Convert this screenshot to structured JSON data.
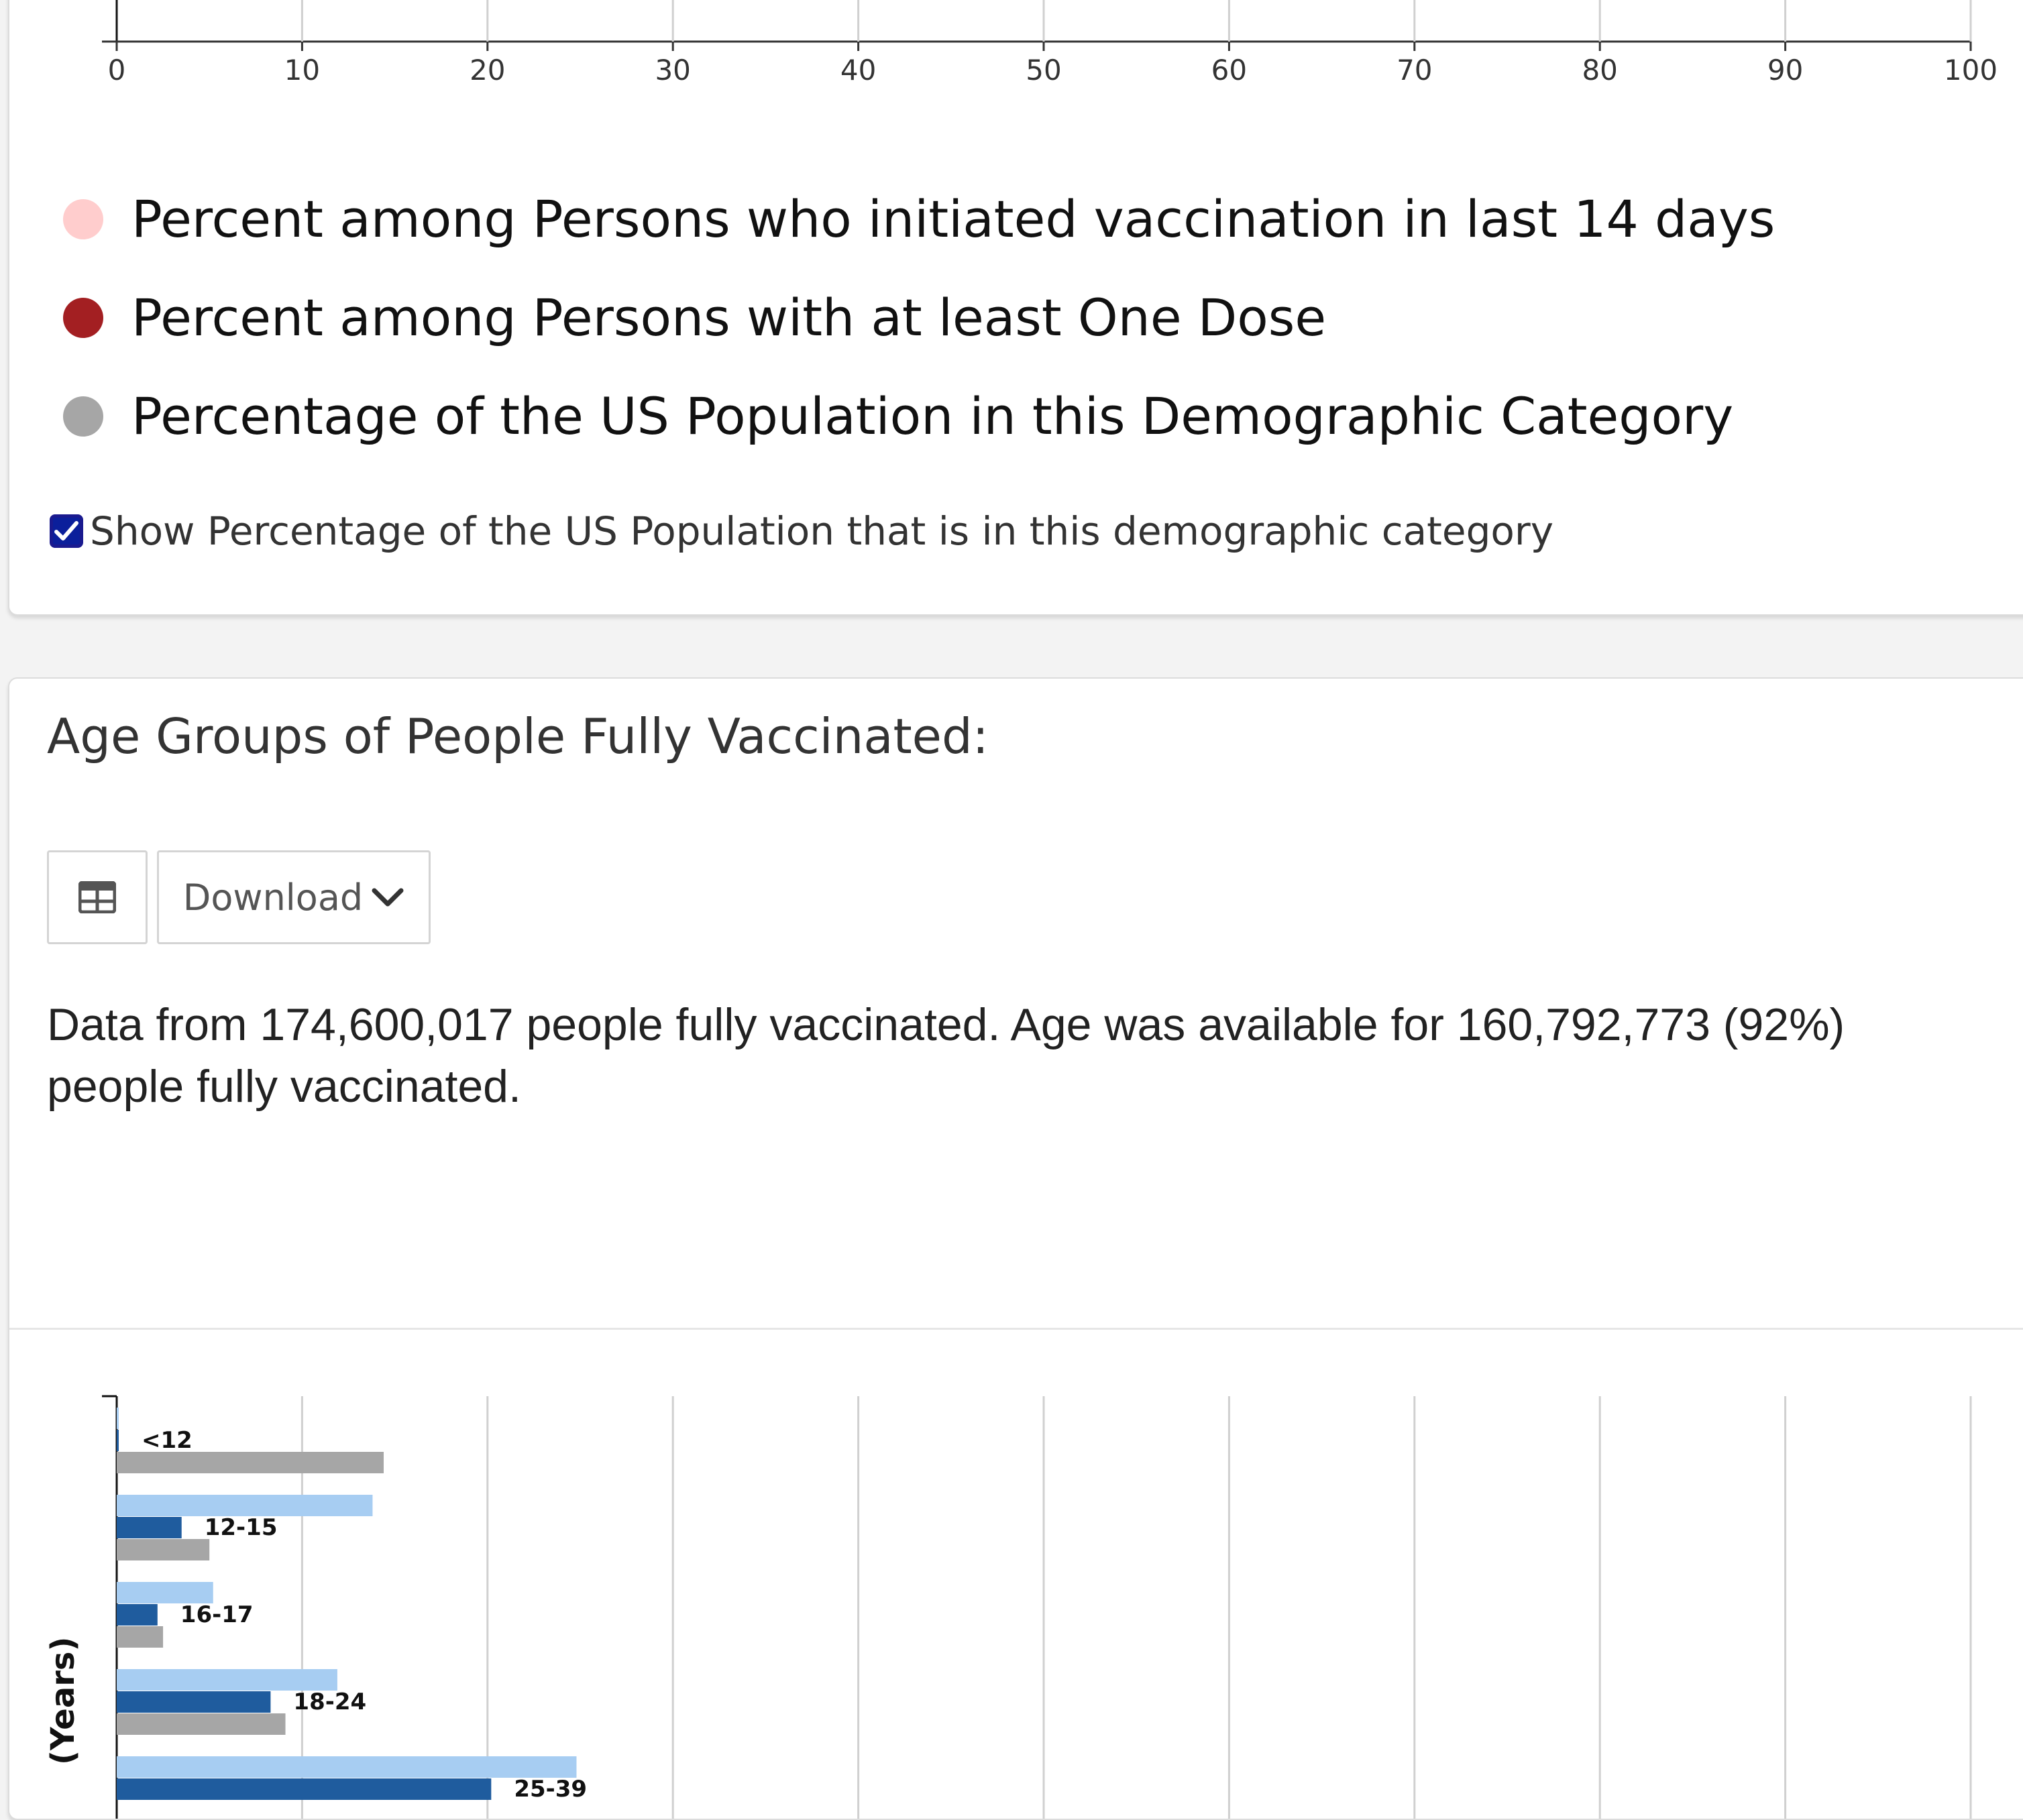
{
  "top_chart": {
    "x_ticks": [
      "0",
      "10",
      "20",
      "30",
      "40",
      "50",
      "60",
      "70",
      "80",
      "90",
      "100"
    ],
    "legend": [
      {
        "label": "Percent among Persons who initiated vaccination in last 14 days",
        "color": "#ffcdcd"
      },
      {
        "label": "Percent among Persons with at least One Dose",
        "color": "#a31f22"
      },
      {
        "label": "Percentage of the US Population in this Demographic Category",
        "color": "#a6a6a6"
      }
    ],
    "checkbox_label": "Show Percentage of the US Population that is in this demographic category",
    "checkbox_checked": true
  },
  "age_section": {
    "title": "Age Groups of People Fully Vaccinated:",
    "table_icon": "table-icon",
    "download_label": "Download",
    "summary": "Data from 174,600,017 people fully vaccinated. Age was available for 160,792,773 (92%) people fully vaccinated."
  },
  "chart_data": {
    "type": "bar",
    "orientation": "horizontal",
    "ylabel": "(Years)",
    "xlim": [
      0,
      100
    ],
    "grid": true,
    "categories": [
      "<12",
      "12-15",
      "16-17",
      "18-24",
      "25-39"
    ],
    "series": [
      {
        "color": "#a7cdf2",
        "values": [
          0,
          13.8,
          5.2,
          11.9,
          24.8
        ]
      },
      {
        "color": "#1f5c9e",
        "values": [
          0.1,
          3.5,
          2.2,
          8.3,
          20.2
        ]
      },
      {
        "color": "#a6a6a6",
        "values": [
          14.4,
          5.0,
          2.5,
          9.1,
          null
        ]
      }
    ]
  }
}
